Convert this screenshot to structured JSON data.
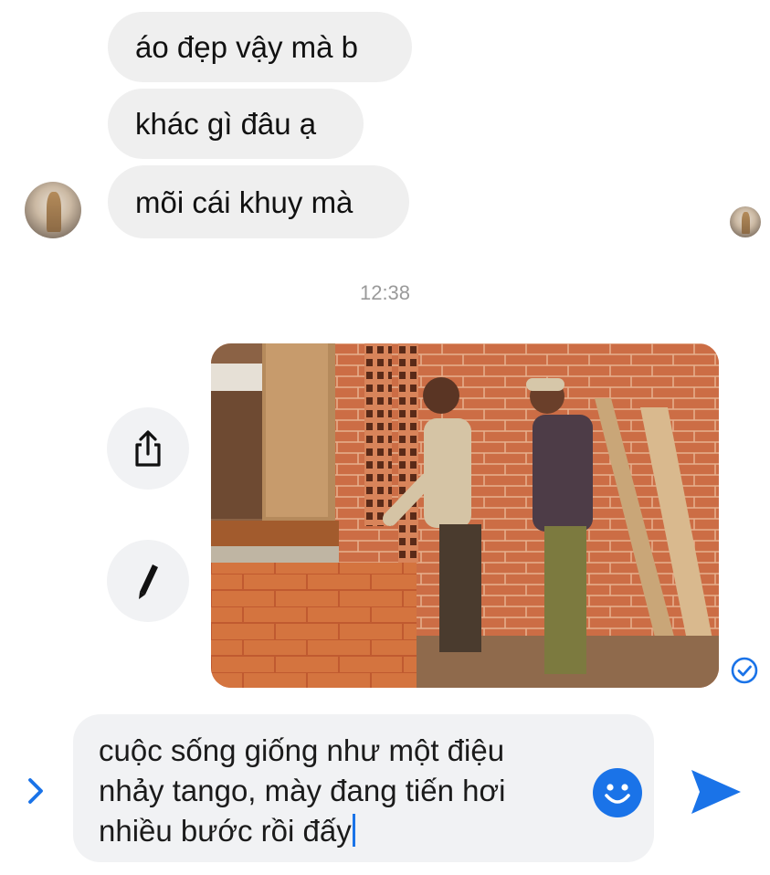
{
  "messages": [
    {
      "text": "áo đẹp vậy mà b"
    },
    {
      "text": "khác gì đâu ạ"
    },
    {
      "text": "mõi cái khuy mà"
    }
  ],
  "timestamp": "12:38",
  "composer": {
    "text": "cuộc sống giống như một điệu\nnhảy tango, mày đang tiến hơi\nnhiều bước rồi đấy"
  },
  "icons": {
    "share": "share-icon",
    "edit": "pencil-icon",
    "seen": "check-circle-icon",
    "expand": "chevron-right-icon",
    "emoji": "smiley-icon",
    "send": "send-icon"
  },
  "colors": {
    "accent": "#1a73e8",
    "bubble": "#efefef",
    "timestamp": "#9a9a9a"
  }
}
